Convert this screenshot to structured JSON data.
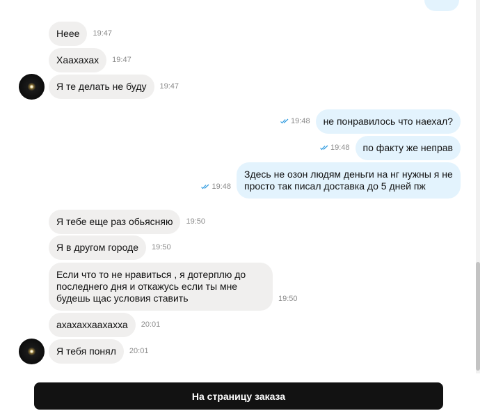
{
  "chat": {
    "messages": [
      {
        "text": "Неее",
        "time": "19:47"
      },
      {
        "text": "Хаахахах",
        "time": "19:47"
      },
      {
        "text": "Я те делать не буду",
        "time": "19:47"
      },
      {
        "text": "не понравилось что наехал?",
        "time": "19:48"
      },
      {
        "text": "по факту же неправ",
        "time": "19:48"
      },
      {
        "text": "Здесь не озон людям деньги на нг нужны я не просто так писал доставка до 5 дней пж",
        "time": "19:48"
      },
      {
        "text": "Я тебе еще раз обьясняю",
        "time": "19:50"
      },
      {
        "text": "Я в другом городе",
        "time": "19:50"
      },
      {
        "text": "Если что то не нравиться , я дотерплю до последнего дня и откажусь если ты мне будешь щас условия ставить",
        "time": "19:50"
      },
      {
        "text": "ахахаххаахахха",
        "time": "20:01"
      },
      {
        "text": "Я тебя понял",
        "time": "20:01"
      }
    ]
  },
  "footer": {
    "order_button": "На страницу заказа"
  },
  "colors": {
    "incoming": "#f0efee",
    "outgoing": "#e3f3fd",
    "read_ticks": "#2f9be0",
    "button": "#121212"
  },
  "icons": {
    "read_status": "double-check-icon",
    "avatar": "avatar-image"
  }
}
